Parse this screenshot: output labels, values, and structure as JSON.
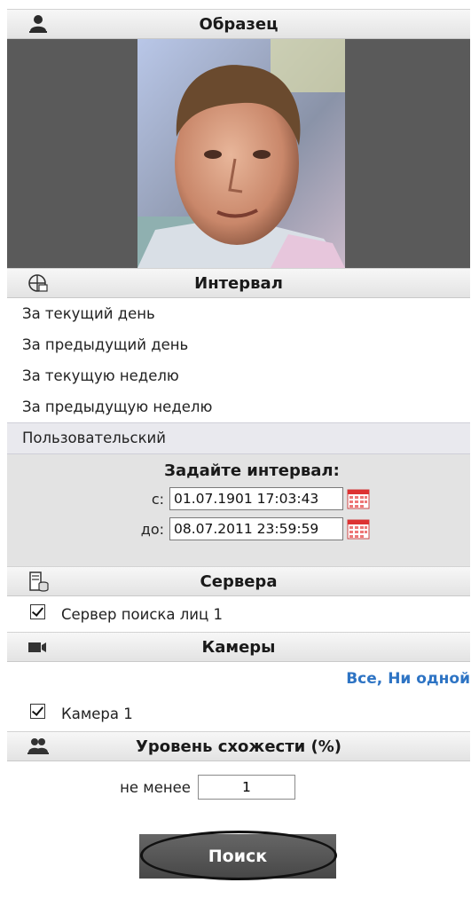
{
  "sample": {
    "header": "Образец"
  },
  "interval": {
    "header": "Интервал",
    "options": [
      "За текущий день",
      "За предыдущий день",
      "За текущую неделю",
      "За предыдущую неделю",
      "Пользовательский"
    ],
    "selected_index": 4,
    "custom_title": "Задайте интервал:",
    "from_label": "с:",
    "from_value": "01.07.1901 17:03:43",
    "to_label": "до:",
    "to_value": "08.07.2011 23:59:59"
  },
  "servers": {
    "header": "Сервера",
    "items": [
      {
        "label": "Сервер поиска лиц 1",
        "checked": true
      }
    ]
  },
  "cameras": {
    "header": "Камеры",
    "all_label": "Все",
    "separator": ",",
    "none_label": "Ни одной",
    "items": [
      {
        "label": "Камера 1",
        "checked": true
      }
    ]
  },
  "similarity": {
    "header": "Уровень схожести (%)",
    "min_label": "не менее",
    "min_value": "1"
  },
  "search": {
    "button_label": "Поиск"
  },
  "colors": {
    "link": "#2e74c4",
    "header_bg": "#e3e3e3",
    "photo_bg": "#5a5a5a"
  }
}
